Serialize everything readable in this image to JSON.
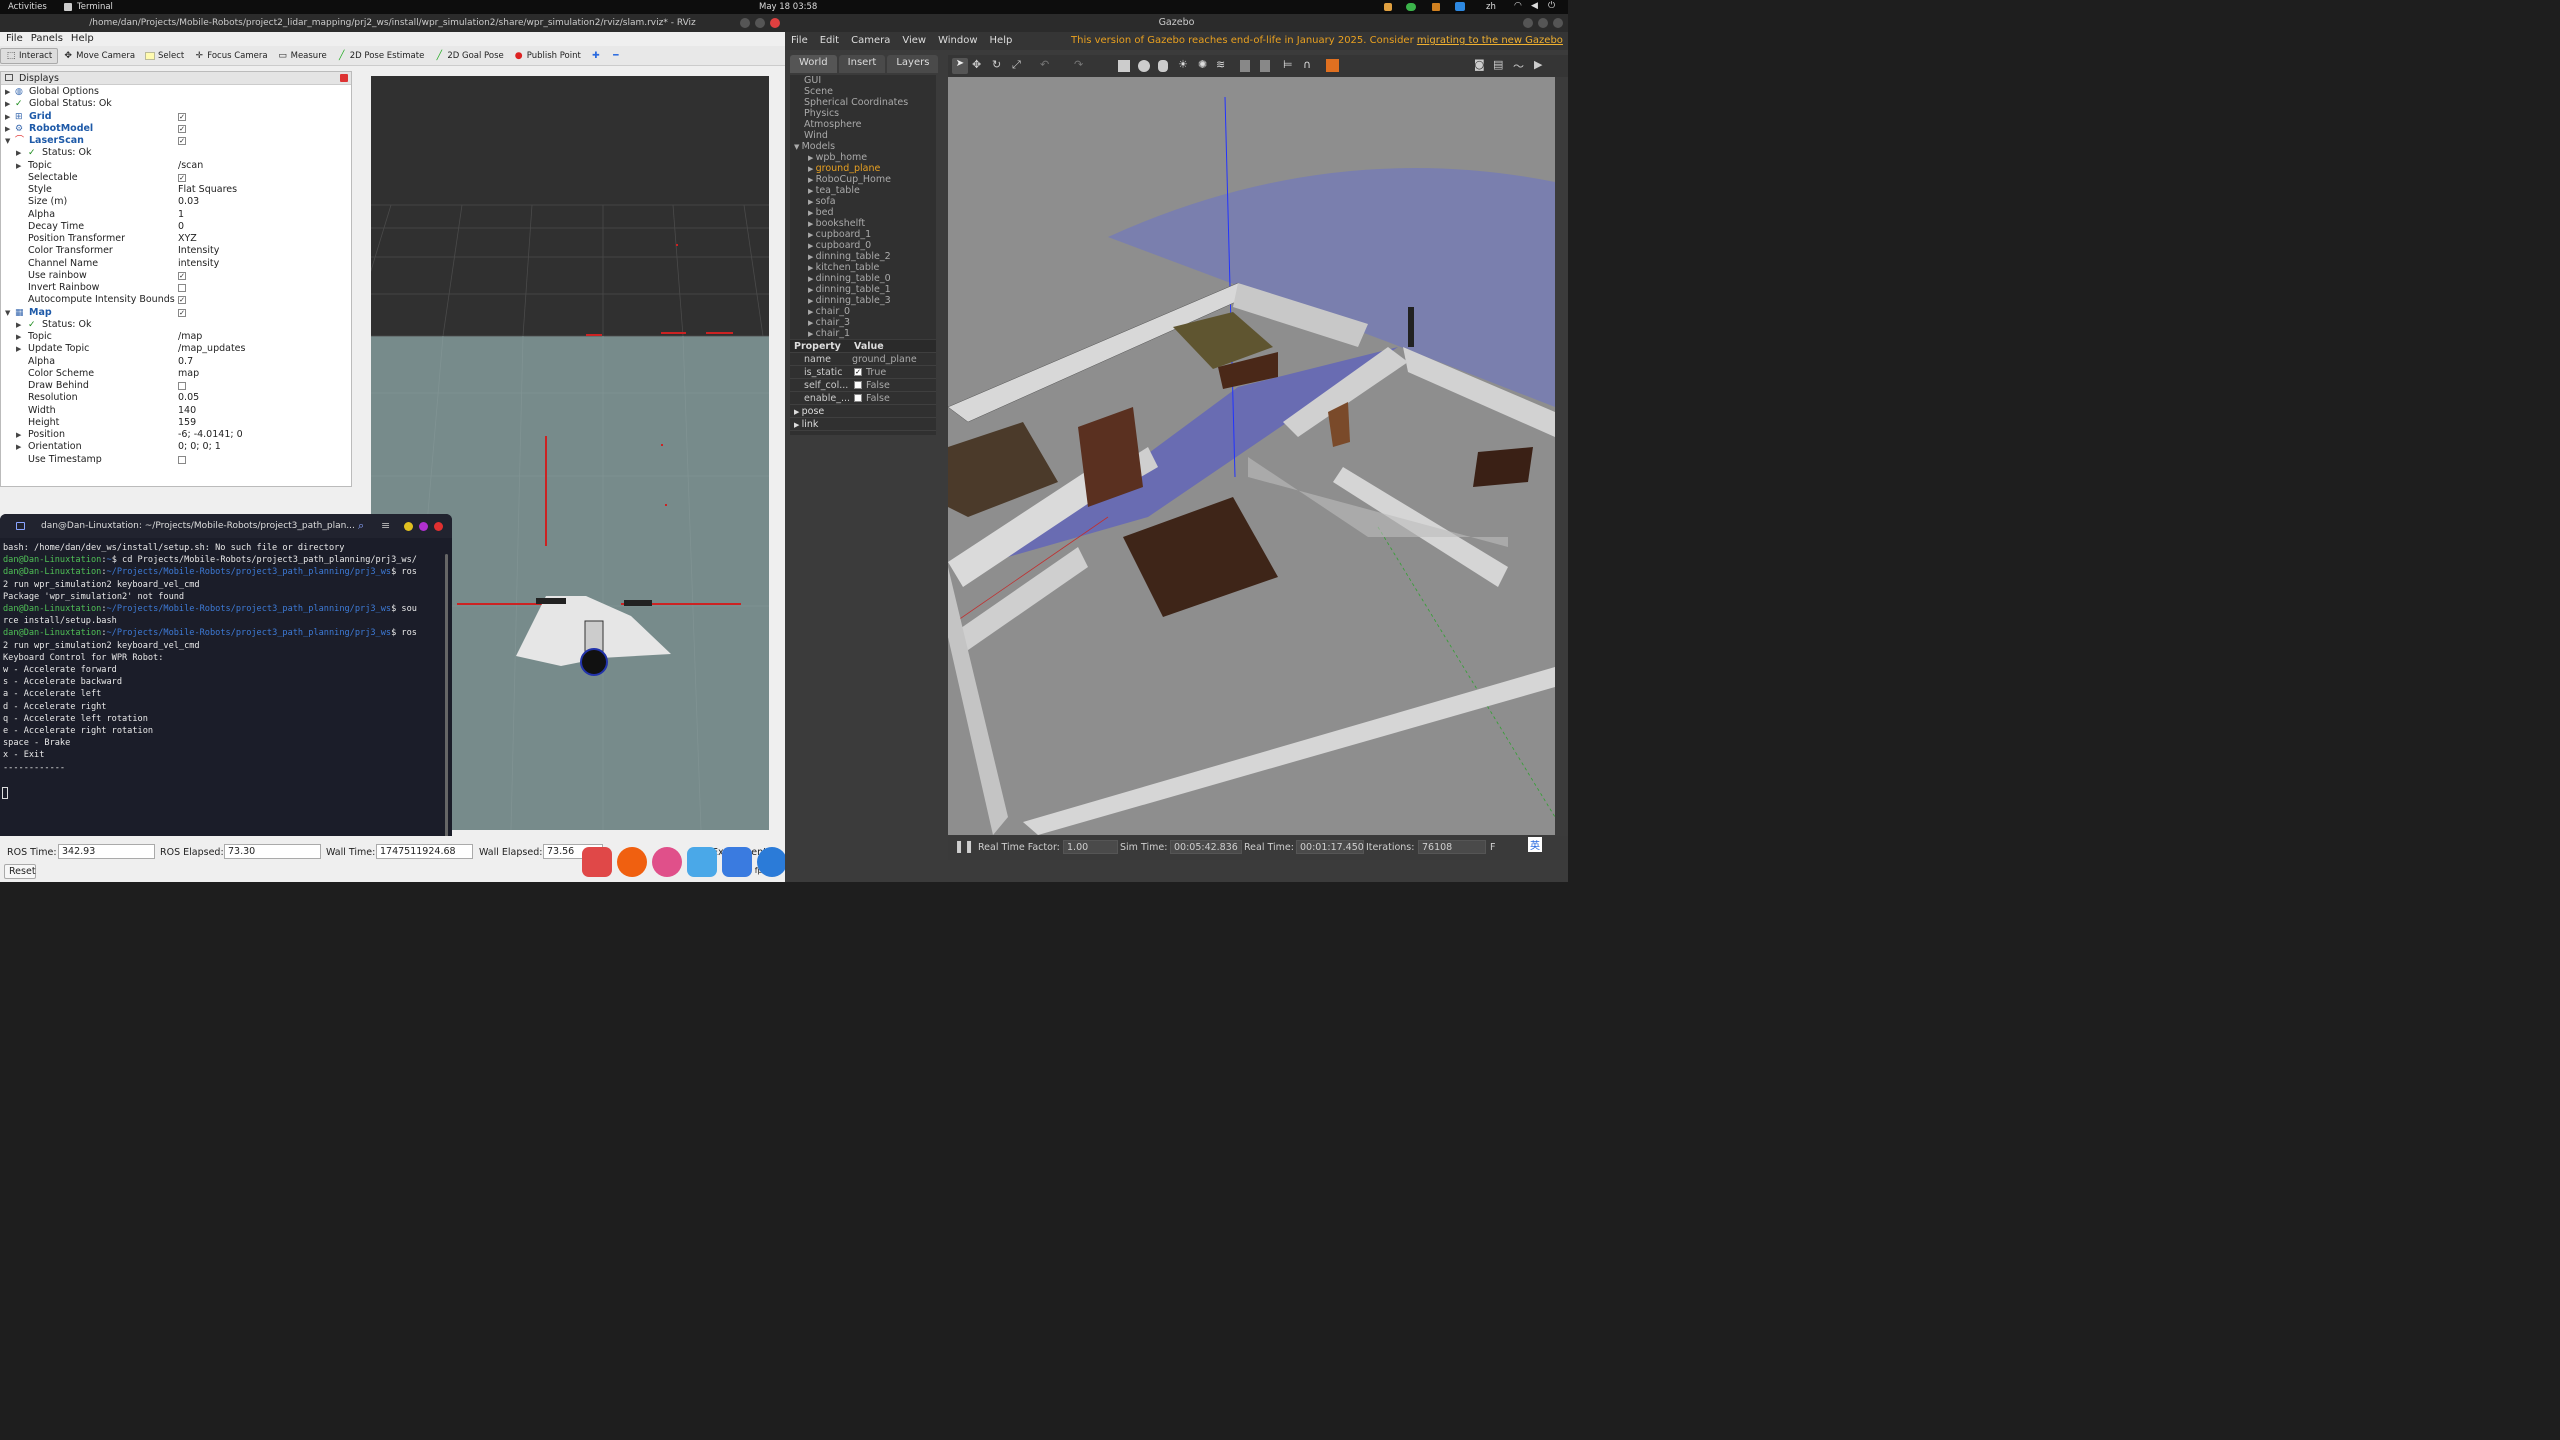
{
  "topbar": {
    "activities": "Activities",
    "app": "Terminal",
    "datetime": "May 18  03:58",
    "lang": "zh"
  },
  "rviz": {
    "title": "/home/dan/Projects/Mobile-Robots/project2_lidar_mapping/prj2_ws/install/wpr_simulation2/share/wpr_simulation2/rviz/slam.rviz* - RViz",
    "menu": [
      "File",
      "Panels",
      "Help"
    ],
    "toolbar": [
      "Interact",
      "Move Camera",
      "Select",
      "Focus Camera",
      "Measure",
      "2D Pose Estimate",
      "2D Goal Pose",
      "Publish Point"
    ],
    "displays_title": "Displays",
    "rows": [
      {
        "label": "Global Options",
        "value": ""
      },
      {
        "label": "Global Status: Ok",
        "value": ""
      },
      {
        "label": "Grid",
        "value": ""
      },
      {
        "label": "RobotModel",
        "value": ""
      },
      {
        "label": "LaserScan",
        "value": ""
      },
      {
        "label": "Status: Ok",
        "value": ""
      },
      {
        "label": "Topic",
        "value": "/scan"
      },
      {
        "label": "Selectable",
        "value": ""
      },
      {
        "label": "Style",
        "value": "Flat Squares"
      },
      {
        "label": "Size (m)",
        "value": "0.03"
      },
      {
        "label": "Alpha",
        "value": "1"
      },
      {
        "label": "Decay Time",
        "value": "0"
      },
      {
        "label": "Position Transformer",
        "value": "XYZ"
      },
      {
        "label": "Color Transformer",
        "value": "Intensity"
      },
      {
        "label": "Channel Name",
        "value": "intensity"
      },
      {
        "label": "Use rainbow",
        "value": ""
      },
      {
        "label": "Invert Rainbow",
        "value": ""
      },
      {
        "label": "Autocompute Intensity Bounds",
        "value": ""
      },
      {
        "label": "Map",
        "value": ""
      },
      {
        "label": "Status: Ok",
        "value": ""
      },
      {
        "label": "Topic",
        "value": "/map"
      },
      {
        "label": "Update Topic",
        "value": "/map_updates"
      },
      {
        "label": "Alpha",
        "value": "0.7"
      },
      {
        "label": "Color Scheme",
        "value": "map"
      },
      {
        "label": "Draw Behind",
        "value": ""
      },
      {
        "label": "Resolution",
        "value": "0.05"
      },
      {
        "label": "Width",
        "value": "140"
      },
      {
        "label": "Height",
        "value": "159"
      },
      {
        "label": "Position",
        "value": "-6; -4.0141; 0"
      },
      {
        "label": "Orientation",
        "value": "0; 0; 0; 1"
      },
      {
        "label": "Use Timestamp",
        "value": ""
      }
    ],
    "status": {
      "ros_time_label": "ROS Time:",
      "ros_time": "342.93",
      "ros_elapsed_label": "ROS Elapsed:",
      "ros_elapsed": "73.30",
      "wall_time_label": "Wall Time:",
      "wall_time": "1747511924.68",
      "wall_elapsed_label": "Wall Elapsed:",
      "wall_elapsed": "73.56",
      "experimental": "Experimental",
      "fps": "31 fps",
      "reset": "Reset"
    }
  },
  "terminal": {
    "title": "dan@Dan-Linuxtation: ~/Projects/Mobile-Robots/project3_path_plan...",
    "lines": [
      {
        "type": "plain",
        "text": "bash: /home/dan/dev_ws/install/setup.sh: No such file or directory"
      },
      {
        "type": "prompt",
        "user": "dan@Dan-Linuxtation",
        "path": "~",
        "cmd": "$ cd Projects/Mobile-Robots/project3_path_planning/prj3_ws/"
      },
      {
        "type": "prompt",
        "user": "dan@Dan-Linuxtation",
        "path": "~/Projects/Mobile-Robots/project3_path_planning/prj3_ws",
        "cmd": "$ ros"
      },
      {
        "type": "plain",
        "text": "2 run wpr_simulation2 keyboard_vel_cmd"
      },
      {
        "type": "plain",
        "text": "Package 'wpr_simulation2' not found"
      },
      {
        "type": "prompt",
        "user": "dan@Dan-Linuxtation",
        "path": "~/Projects/Mobile-Robots/project3_path_planning/prj3_ws",
        "cmd": "$ sou"
      },
      {
        "type": "plain",
        "text": "rce install/setup.bash"
      },
      {
        "type": "prompt",
        "user": "dan@Dan-Linuxtation",
        "path": "~/Projects/Mobile-Robots/project3_path_planning/prj3_ws",
        "cmd": "$ ros"
      },
      {
        "type": "plain",
        "text": "2 run wpr_simulation2 keyboard_vel_cmd"
      },
      {
        "type": "plain",
        "text": "Keyboard Control for WPR Robot:"
      },
      {
        "type": "plain",
        "text": "w - Accelerate forward"
      },
      {
        "type": "plain",
        "text": "s - Accelerate backward"
      },
      {
        "type": "plain",
        "text": "a - Accelerate left"
      },
      {
        "type": "plain",
        "text": "d - Accelerate right"
      },
      {
        "type": "plain",
        "text": "q - Accelerate left rotation"
      },
      {
        "type": "plain",
        "text": "e - Accelerate right rotation"
      },
      {
        "type": "plain",
        "text": "space - Brake"
      },
      {
        "type": "plain",
        "text": "x - Exit"
      },
      {
        "type": "plain",
        "text": "------------"
      }
    ]
  },
  "gazebo": {
    "title": "Gazebo",
    "menu": [
      "File",
      "Edit",
      "Camera",
      "View",
      "Window",
      "Help"
    ],
    "eol_text": "This version of Gazebo reaches end-of-life in January 2025. Consider ",
    "eol_link": "migrating to the new Gazebo",
    "tabs": [
      "World",
      "Insert",
      "Layers"
    ],
    "world_items": [
      "GUI",
      "Scene",
      "Spherical Coordinates",
      "Physics",
      "Atmosphere",
      "Wind",
      "Models"
    ],
    "models": [
      "wpb_home",
      "ground_plane",
      "RoboCup_Home",
      "tea_table",
      "sofa",
      "bed",
      "bookshelft",
      "cupboard_1",
      "cupboard_0",
      "dinning_table_2",
      "kitchen_table",
      "dinning_table_0",
      "dinning_table_1",
      "dinning_table_3",
      "chair_0",
      "chair_3",
      "chair_1"
    ],
    "selected_model": "ground_plane",
    "prop_header": [
      "Property",
      "Value"
    ],
    "props": [
      {
        "name": "name",
        "value": "ground_plane"
      },
      {
        "name": "is_static",
        "value": "True"
      },
      {
        "name": "self_col...",
        "value": "False"
      },
      {
        "name": "enable_...",
        "value": "False"
      }
    ],
    "prop_groups": [
      "pose",
      "link"
    ],
    "bottom": {
      "rtf_label": "Real Time Factor:",
      "rtf": "1.00",
      "sim_label": "Sim Time:",
      "sim": "00:05:42.836",
      "real_label": "Real Time:",
      "real": "00:01:17.450",
      "iter_label": "Iterations:",
      "iter": "76108",
      "fps_label": "F"
    },
    "tray": "英"
  },
  "colors": {
    "prompt_green": "#4fbf56",
    "path_blue": "#3d7ad6",
    "eol_orange": "#e8a020",
    "laser_blue": "#3a3adf"
  }
}
